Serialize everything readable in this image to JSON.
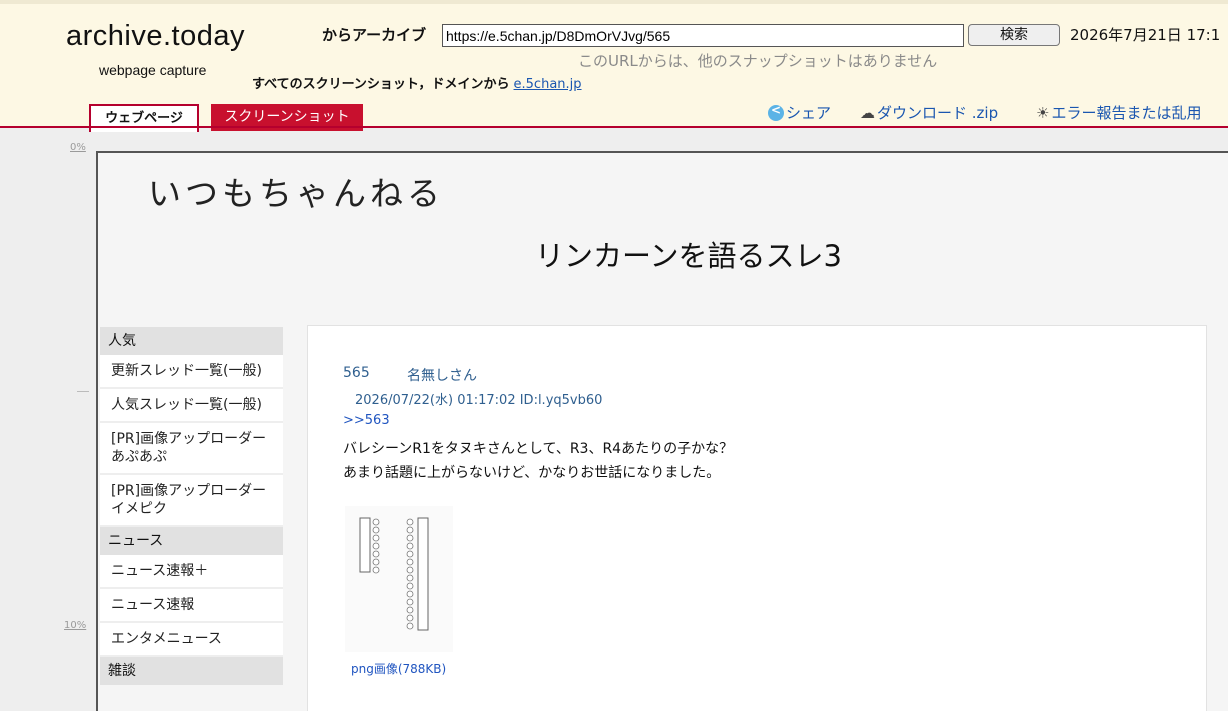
{
  "archive": {
    "logo": "archive.today",
    "logo_sub": "webpage capture",
    "archive_label": "からアーカイブ",
    "url": "https://e.5chan.jp/D8DmOrVJvg/565",
    "search_button": "検索",
    "capture_date": "2026年7月21日 17:1",
    "no_other_snapshots": "このURLからは、他のスナップショットはありません",
    "all_screenshots_label": "すべてのスクリーンショット，ドメインから",
    "domain_link": "e.5chan.jp",
    "tab_webpage": "ウェブページ",
    "tab_screenshot": "スクリーンショット",
    "share": "シェア",
    "download": "ダウンロード .zip",
    "report": "エラー報告または乱用"
  },
  "ruler": {
    "top": "0%",
    "mid": "10%"
  },
  "page": {
    "site_title": "いつもちゃんねる",
    "thread_title": "リンカーンを語るスレ3",
    "menu": [
      {
        "type": "category",
        "label": "人気"
      },
      {
        "type": "item",
        "label": "更新スレッド一覧(一般)"
      },
      {
        "type": "item",
        "label": "人気スレッド一覧(一般)"
      },
      {
        "type": "item",
        "label": "[PR]画像アップローダー\nあぷあぷ"
      },
      {
        "type": "item",
        "label": "[PR]画像アップローダー\nイメピク"
      },
      {
        "type": "category",
        "label": "ニュース"
      },
      {
        "type": "item",
        "label": "ニュース速報＋"
      },
      {
        "type": "item",
        "label": "ニュース速報"
      },
      {
        "type": "item",
        "label": "エンタメニュース"
      },
      {
        "type": "category",
        "label": "雑談"
      }
    ],
    "post": {
      "number": "565",
      "name": "名無しさん",
      "meta": "2026/07/22(水) 01:17:02 ID:l.yq5vb60",
      "reply_ref": ">>563",
      "lines": [
        "バレシーンR1をタヌキさんとして、R3、R4あたりの子かな？",
        "あまり話題に上がらないけど、かなりお世話になりました。"
      ],
      "image_caption": "png画像(788KB)"
    }
  },
  "colors": {
    "accent": "#b5002e",
    "link": "#1a56b0",
    "header_bg": "#fdf8e4"
  }
}
